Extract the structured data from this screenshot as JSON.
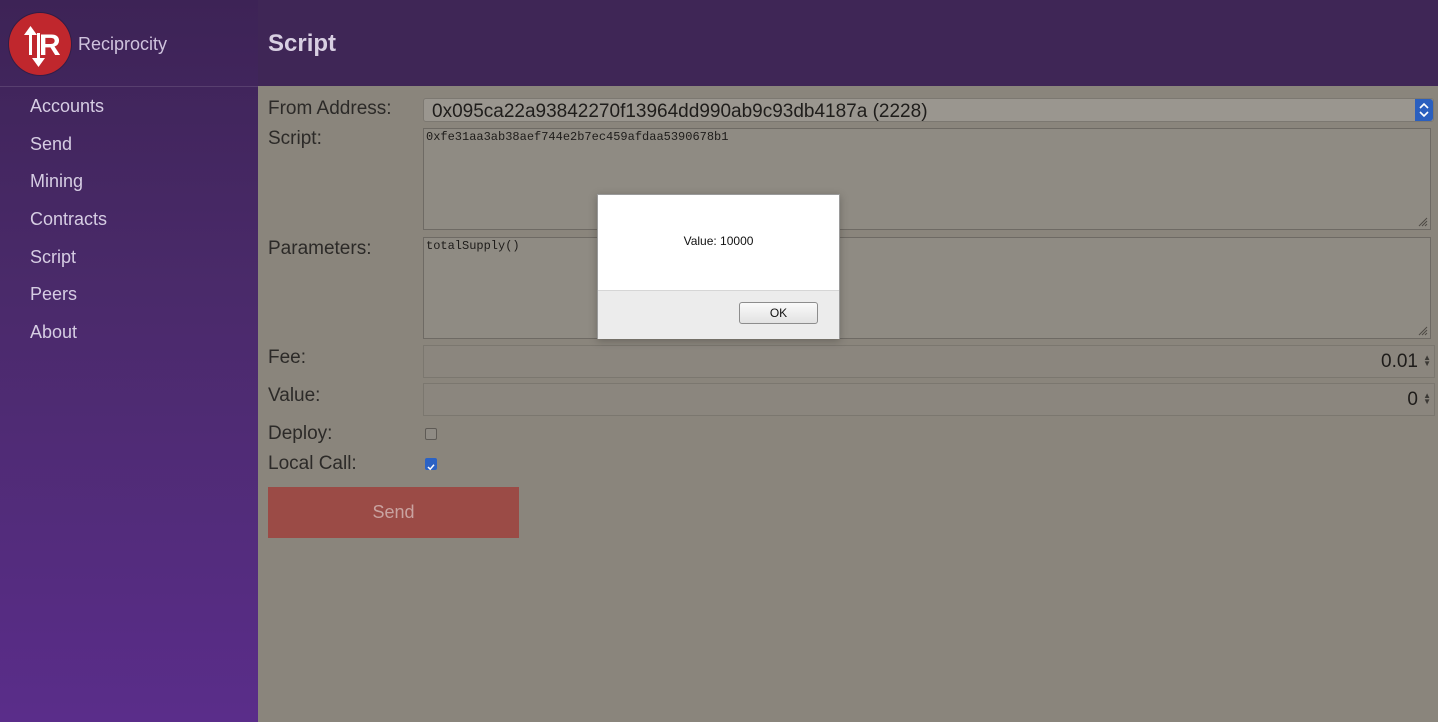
{
  "app": {
    "name": "Reciprocity",
    "logo_text": "R"
  },
  "nav": {
    "items": [
      {
        "label": "Accounts"
      },
      {
        "label": "Send"
      },
      {
        "label": "Mining"
      },
      {
        "label": "Contracts"
      },
      {
        "label": "Script"
      },
      {
        "label": "Peers"
      },
      {
        "label": "About"
      }
    ]
  },
  "page": {
    "title": "Script"
  },
  "form": {
    "from_label": "From Address:",
    "from_value": "0x095ca22a93842270f13964dd990ab9c93db4187a (2228)",
    "script_label": "Script:",
    "script_value": "0xfe31aa3ab38aef744e2b7ec459afdaa5390678b1",
    "params_label": "Parameters:",
    "params_value": "totalSupply()",
    "fee_label": "Fee:",
    "fee_value": "0.01",
    "value_label": "Value:",
    "value_value": "0",
    "deploy_label": "Deploy:",
    "deploy_checked": false,
    "localcall_label": "Local Call:",
    "localcall_checked": true,
    "send_label": "Send"
  },
  "dialog": {
    "message": "Value: 10000",
    "ok_label": "OK"
  },
  "colors": {
    "sidebar_top": "#3d2356",
    "sidebar_bottom": "#5a2d8a",
    "logo": "#c0272d",
    "send_button": "#9b4b46",
    "overlay_bg": "#8a857c"
  }
}
